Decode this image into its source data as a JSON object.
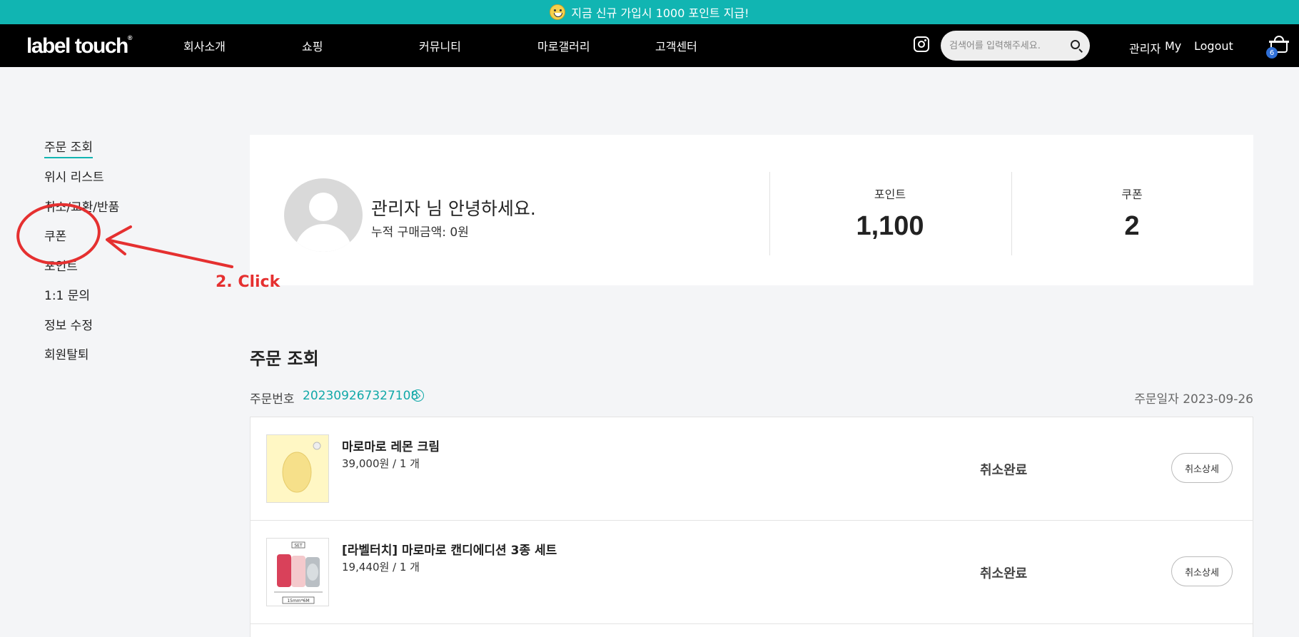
{
  "promo": {
    "text": "지금 신규 가입시 1000 포인트 지급!"
  },
  "header": {
    "logo": "label touch",
    "nav": [
      "회사소개",
      "쇼핑",
      "커뮤니티",
      "마로갤러리",
      "고객센터"
    ],
    "search_placeholder": "검색어를 입력해주세요.",
    "user_label": "관리자",
    "my_label": "My",
    "logout_label": "Logout",
    "cart_count": "6"
  },
  "sidebar": {
    "items": [
      "주문 조회",
      "위시 리스트",
      "취소/교환/반품",
      "쿠폰",
      "포인트",
      "1:1 문의",
      "정보 수정",
      "회원탈퇴"
    ]
  },
  "annotation": {
    "text": "2. Click",
    "color": "#e53030"
  },
  "profile": {
    "greeting": "관리자 님 안녕하세요.",
    "purchase_total": "누적 구매금액: 0원",
    "points_label": "포인트",
    "points_value": "1,100",
    "coupon_label": "쿠폰",
    "coupon_value": "2"
  },
  "orders": {
    "title": "주문 조회",
    "order_no_label": "주문번호",
    "order_no": "202309267327108",
    "order_date": "주문일자 2023-09-26",
    "items": [
      {
        "name": "마로마로 레몬 크림",
        "price": "39,000원 / 1 개",
        "status": "취소완료",
        "button": "취소상세"
      },
      {
        "name": "[라벨터치] 마로마로 캔디에디션 3종 세트",
        "price": "19,440원 / 1 개",
        "status": "취소완료",
        "button": "취소상세",
        "thumb_badge": "SET",
        "thumb_caption": "15mm*6M"
      }
    ]
  },
  "colors": {
    "accent": "#11b5b2",
    "navbar": "#000000",
    "annotation": "#e53030"
  }
}
